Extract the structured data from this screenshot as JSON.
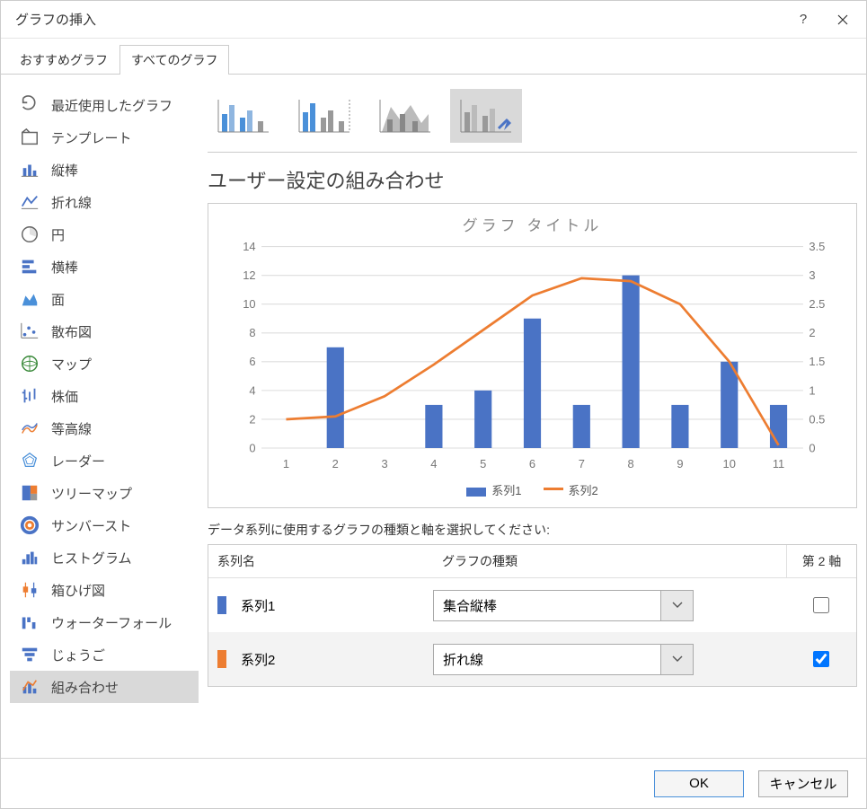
{
  "window": {
    "title": "グラフの挿入"
  },
  "tabs": {
    "recommended": "おすすめグラフ",
    "all": "すべてのグラフ"
  },
  "sidebar": {
    "items": [
      {
        "key": "recent",
        "label": "最近使用したグラフ"
      },
      {
        "key": "template",
        "label": "テンプレート"
      },
      {
        "key": "column",
        "label": "縦棒"
      },
      {
        "key": "line",
        "label": "折れ線"
      },
      {
        "key": "pie",
        "label": "円"
      },
      {
        "key": "bar",
        "label": "横棒"
      },
      {
        "key": "area",
        "label": "面"
      },
      {
        "key": "scatter",
        "label": "散布図"
      },
      {
        "key": "map",
        "label": "マップ"
      },
      {
        "key": "stock",
        "label": "株価"
      },
      {
        "key": "surface",
        "label": "等高線"
      },
      {
        "key": "radar",
        "label": "レーダー"
      },
      {
        "key": "treemap",
        "label": "ツリーマップ"
      },
      {
        "key": "sunburst",
        "label": "サンバースト"
      },
      {
        "key": "histogram",
        "label": "ヒストグラム"
      },
      {
        "key": "boxwhisker",
        "label": "箱ひげ図"
      },
      {
        "key": "waterfall",
        "label": "ウォーターフォール"
      },
      {
        "key": "funnel",
        "label": "じょうご"
      },
      {
        "key": "combo",
        "label": "組み合わせ"
      }
    ],
    "selected": "combo"
  },
  "main": {
    "section_title": "ユーザー設定の組み合わせ",
    "preview_title": "グラフ タイトル",
    "series_intro": "データ系列に使用するグラフの種類と軸を選択してください:",
    "headers": {
      "name": "系列名",
      "type": "グラフの種類",
      "axis": "第 2 軸"
    },
    "rows": [
      {
        "name": "系列1",
        "type": "集合縦棒",
        "color": "#4a73c5",
        "secondary": false
      },
      {
        "name": "系列2",
        "type": "折れ線",
        "color": "#ed7d31",
        "secondary": true
      }
    ],
    "legend": {
      "s1": "系列1",
      "s2": "系列2"
    }
  },
  "footer": {
    "ok": "OK",
    "cancel": "キャンセル"
  },
  "chart_data": {
    "type": "combo",
    "title": "グラフ タイトル",
    "categories": [
      1,
      2,
      3,
      4,
      5,
      6,
      7,
      8,
      9,
      10,
      11
    ],
    "y_left": {
      "min": 0,
      "max": 14,
      "step": 2
    },
    "y_right": {
      "min": 0,
      "max": 3.5,
      "step": 0.5
    },
    "series": [
      {
        "name": "系列1",
        "type": "bar",
        "axis": "left",
        "color": "#4a73c5",
        "values": [
          null,
          7,
          null,
          3,
          4,
          9,
          3,
          12,
          3,
          6,
          3
        ]
      },
      {
        "name": "系列2",
        "type": "line",
        "axis": "right",
        "color": "#ed7d31",
        "values": [
          0.5,
          0.55,
          0.9,
          1.45,
          2.05,
          2.65,
          2.95,
          2.9,
          2.5,
          1.5,
          0.05
        ]
      }
    ]
  }
}
